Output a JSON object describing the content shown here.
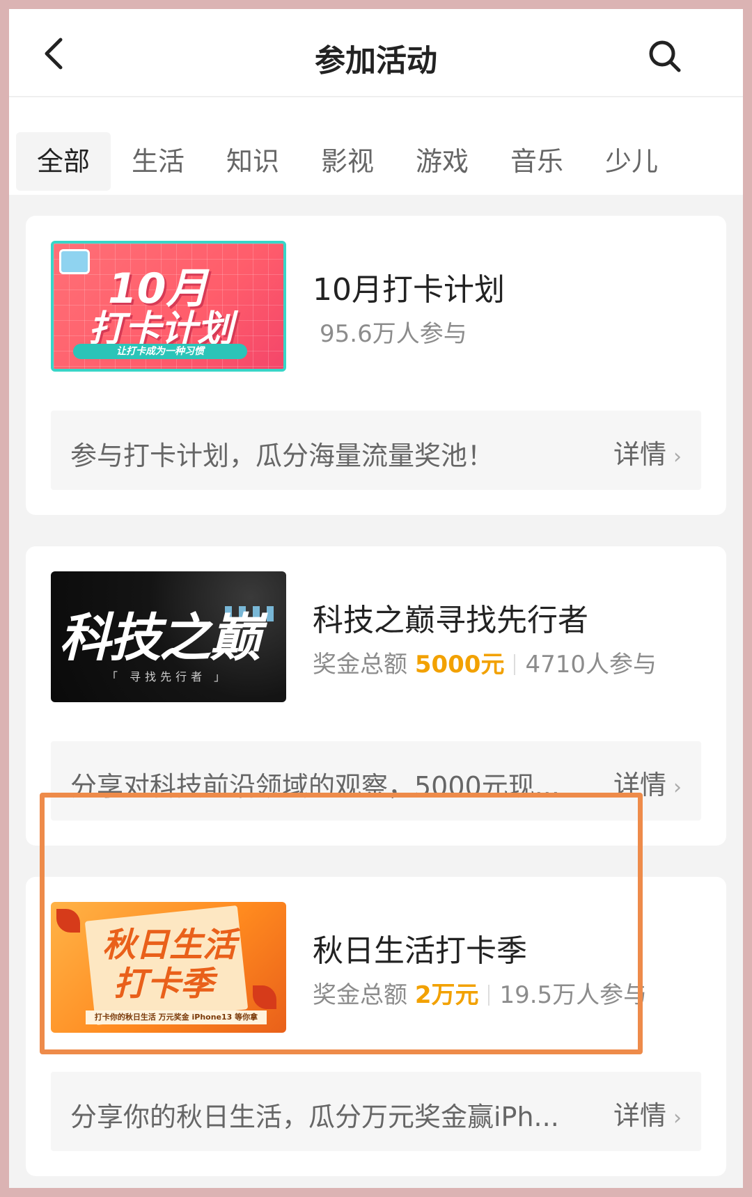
{
  "header": {
    "title": "参加活动",
    "back_icon": "chevron-left-icon",
    "search_icon": "search-icon"
  },
  "tabs": [
    {
      "label": "全部",
      "active": true
    },
    {
      "label": "生活"
    },
    {
      "label": "知识"
    },
    {
      "label": "影视"
    },
    {
      "label": "游戏"
    },
    {
      "label": "音乐"
    },
    {
      "label": "少儿"
    }
  ],
  "activities": [
    {
      "title": "10月打卡计划",
      "participants": "95.6万人参与",
      "description": "参与打卡计划，瓜分海量流量奖池！",
      "detail_label": "详情",
      "thumbnail": {
        "line1": "10月",
        "line2": "打卡计划",
        "strip": "让打卡成为一种习惯"
      }
    },
    {
      "title": "科技之巅寻找先行者",
      "prize_label": "奖金总额",
      "prize_value": "5000元",
      "participants": "4710人参与",
      "description": "分享对科技前沿领域的观察，5000元现...",
      "detail_label": "详情",
      "thumbnail": {
        "line1": "科技之巅",
        "line2": "「 寻找先行者 」"
      }
    },
    {
      "title": "秋日生活打卡季",
      "prize_label": "奖金总额",
      "prize_value": "2万元",
      "participants": "19.5万人参与",
      "description": "分享你的秋日生活，瓜分万元奖金赢iPh...",
      "detail_label": "详情",
      "thumbnail": {
        "line1": "秋日生活",
        "line2": "打卡季",
        "strip": "打卡你的秋日生活 万元奖金 iPhone13 等你拿"
      }
    }
  ],
  "colors": {
    "prize": "#f2a100",
    "highlight_border": "#ee8b4a",
    "outer_frame": "#dbb3b3"
  }
}
